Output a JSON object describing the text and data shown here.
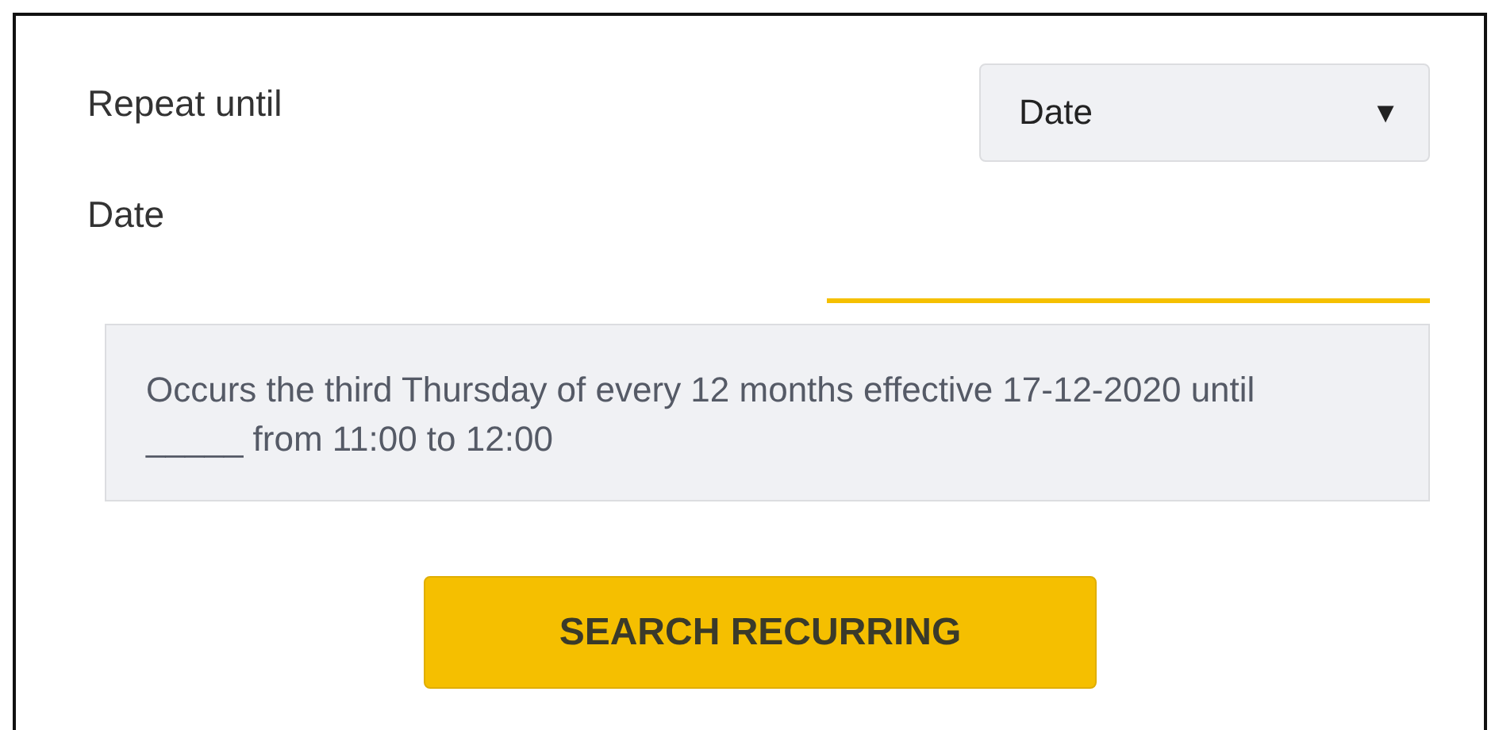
{
  "repeat_until": {
    "label": "Repeat until",
    "select": {
      "value": "Date",
      "caret": "▼"
    }
  },
  "date": {
    "label": "Date"
  },
  "summary": "Occurs the third Thursday of every 12 months effective 17-12-2020 until _____ from 11:00 to 12:00",
  "button": {
    "label": "SEARCH RECURRING"
  }
}
